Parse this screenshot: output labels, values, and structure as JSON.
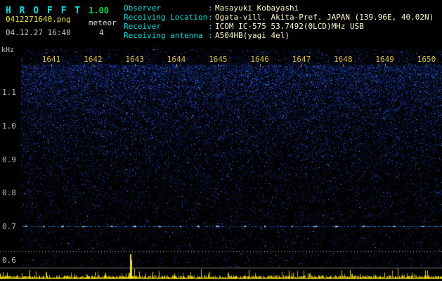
{
  "header": {
    "app_name": "H R O F F T",
    "version": "1.00",
    "filename": "0412271640.png",
    "timestamp": "04.12.27 16:40",
    "meteor_label": "meteor",
    "meteor_count": "4",
    "colon": ":",
    "info": [
      {
        "label": "Observer",
        "value": "Masayuki Kobayashi"
      },
      {
        "label": "Receiving Location",
        "value": "Ogata-vill. Akita-Pref. JAPAN (139.96E, 40.02N)"
      },
      {
        "label": "Receiver",
        "value": "ICOM IC-575 53.7492(0LCD)MHz USB"
      },
      {
        "label": "Receiving antenna",
        "value": "A504HB(yagi 4el)"
      }
    ]
  },
  "spectrogram": {
    "y_axis_unit": "kHz",
    "y_ticks": [
      "1.1",
      "1.0",
      "0.9",
      "0.8",
      "0.7",
      "0.6"
    ],
    "x_ticks": [
      "1641",
      "1642",
      "1643",
      "1644",
      "1645",
      "1646",
      "1647",
      "1648",
      "1649",
      "1650"
    ],
    "carrier_line_khz": "0.7"
  },
  "colors": {
    "background": "#000000",
    "label_cyan": "#00dddd",
    "value_pale_yellow": "#fff8c8",
    "time_tick_yellow": "#d8c040",
    "freq_tick_gray": "#b8b8b8",
    "noise_blue": "#2244cc",
    "waveform_yellow": "#eedd22",
    "version_green": "#00d84a",
    "filename_yellow": "#f0e840"
  }
}
